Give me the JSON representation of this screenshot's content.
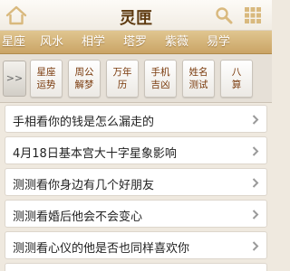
{
  "header": {
    "title": "灵匣",
    "icons": {
      "home": "home-icon",
      "search": "search-icon",
      "menu": "grid-icon"
    }
  },
  "categories": [
    "星座",
    "风水",
    "相学",
    "塔罗",
    "紫薇",
    "易学"
  ],
  "subnav": {
    "more_label": ">>",
    "tools": [
      {
        "line1": "星座",
        "line2": "运势"
      },
      {
        "line1": "周公",
        "line2": "解梦"
      },
      {
        "line1": "万年",
        "line2": "历"
      },
      {
        "line1": "手机",
        "line2": "吉凶"
      },
      {
        "line1": "姓名",
        "line2": "测试"
      },
      {
        "line1": "八",
        "line2": "算"
      }
    ]
  },
  "articles": [
    "手相看你的钱是怎么漏走的",
    "4月18日基本宫大十字星象影响",
    "测测看你身边有几个好朋友",
    "测测看婚后他会不会变心",
    "测测看心仪的他是否也同样喜欢你",
    ""
  ],
  "colors": {
    "accent": "#c9a466",
    "title": "#5e3a10",
    "tool_text": "#7a3a0c"
  }
}
